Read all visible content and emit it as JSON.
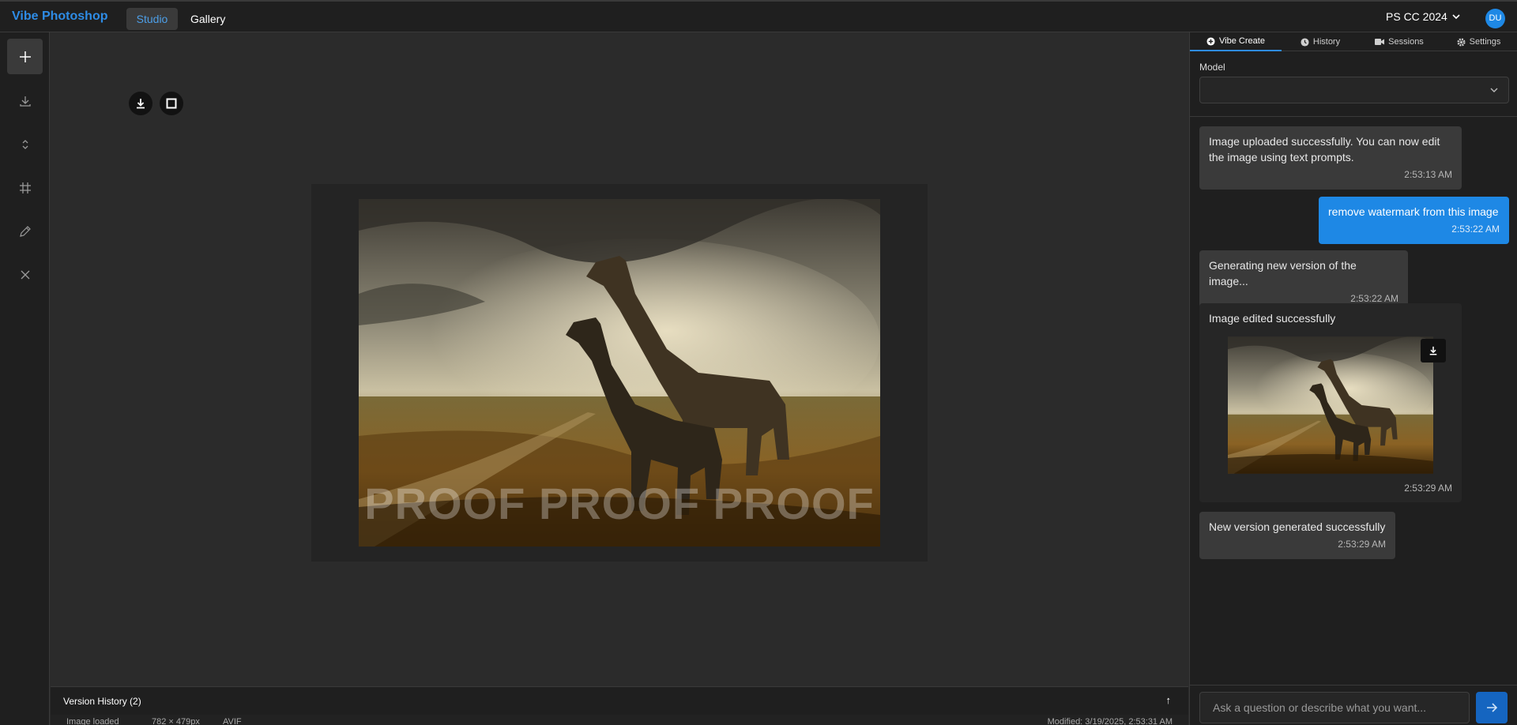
{
  "header": {
    "brand": "Vibe Photoshop",
    "nav": {
      "studio": "Studio",
      "gallery": "Gallery"
    },
    "version": "PS CC 2024",
    "avatar_initials": "DU"
  },
  "toolbar": {
    "tools": [
      {
        "name": "add-icon",
        "active": true
      },
      {
        "name": "download-icon",
        "active": false
      },
      {
        "name": "expand-vertical-icon",
        "active": false
      },
      {
        "name": "crop-grid-icon",
        "active": false
      },
      {
        "name": "pencil-icon",
        "active": false
      },
      {
        "name": "close-icon",
        "active": false
      }
    ]
  },
  "canvas": {
    "watermark_text": "PROOF PROOF PROOF"
  },
  "version_history": {
    "title": "Version History (2)",
    "toggle_icon": "↑"
  },
  "status": {
    "state": "Image loaded",
    "dimensions": "782 × 479px",
    "format": "AVIF",
    "modified": "Modified: 3/19/2025, 2:53:31 AM"
  },
  "panel": {
    "tabs": [
      {
        "label": "Vibe Create",
        "icon": "plus-circle-icon",
        "active": true
      },
      {
        "label": "History",
        "icon": "clock-icon",
        "active": false
      },
      {
        "label": "Sessions",
        "icon": "video-icon",
        "active": false
      },
      {
        "label": "Settings",
        "icon": "gear-icon",
        "active": false
      }
    ],
    "model_label": "Model",
    "model_value": "",
    "messages": [
      {
        "role": "bot",
        "text": "Image uploaded successfully. You can now edit the image using text prompts.",
        "time": "2:53:13 AM"
      },
      {
        "role": "user",
        "text": "remove watermark from this image",
        "time": "2:53:22 AM"
      },
      {
        "role": "bot",
        "text": "Generating new version of the image...",
        "time": "2:53:22 AM"
      },
      {
        "role": "bot",
        "text": "Image edited successfully",
        "time": "2:53:29 AM"
      },
      {
        "role": "bot",
        "text": "New version generated successfully",
        "time": "2:53:29 AM"
      }
    ],
    "input_placeholder": "Ask a question or describe what you want..."
  },
  "colors": {
    "accent": "#2e8ce6",
    "user_bubble": "#1e88e5",
    "send_button": "#1565c0",
    "panel_bg": "#1f1f1f",
    "canvas_bg": "#2b2b2b"
  }
}
